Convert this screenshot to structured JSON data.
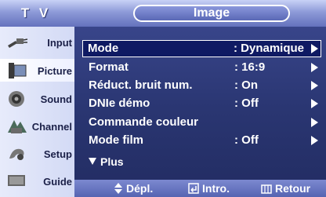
{
  "header": {
    "section": "T V",
    "title": "Image"
  },
  "sidebar": {
    "items": [
      {
        "label": "Input",
        "icon": "input-plug-icon"
      },
      {
        "label": "Picture",
        "icon": "picture-icon"
      },
      {
        "label": "Sound",
        "icon": "sound-speaker-icon"
      },
      {
        "label": "Channel",
        "icon": "channel-icon"
      },
      {
        "label": "Setup",
        "icon": "setup-icon"
      },
      {
        "label": "Guide",
        "icon": "guide-icon"
      }
    ]
  },
  "menu": {
    "rows": [
      {
        "label": "Mode",
        "value": ": Dynamique"
      },
      {
        "label": "Format",
        "value": ": 16:9"
      },
      {
        "label": "Réduct. bruit num.",
        "value": ": On"
      },
      {
        "label": "DNIe démo",
        "value": ": Off"
      },
      {
        "label": "Commande couleur",
        "value": ""
      },
      {
        "label": "Mode film",
        "value": ": Off"
      }
    ],
    "more_label": "Plus"
  },
  "footer": {
    "move": "Dépl.",
    "enter": "Intro.",
    "return": "Retour"
  },
  "colors": {
    "accent": "#6472bd",
    "selected_row": "#0f1a63",
    "background": "#2f3a78"
  }
}
